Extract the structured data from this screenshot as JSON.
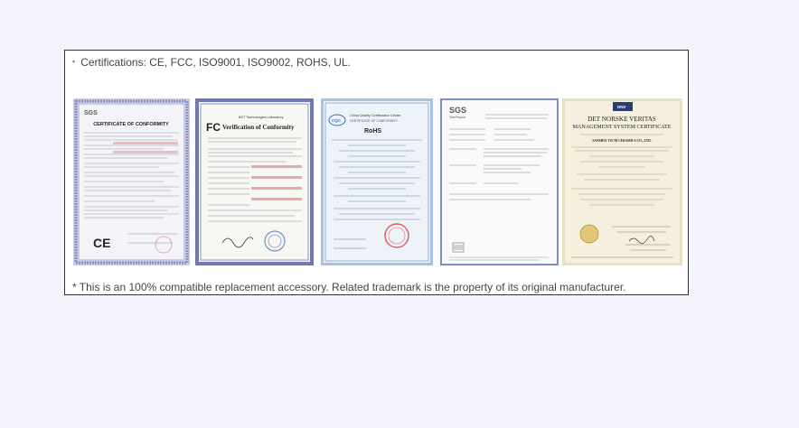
{
  "certifications_line": "Certifications: CE, FCC, ISO9001, ISO9002, ROHS, UL.",
  "bullet_symbol": "▪",
  "footer_note": "* This is an 100% compatible replacement accessory. Related trademark is the property of its original manufacturer.",
  "certificates": [
    {
      "id": "ce",
      "brand": "SGS",
      "title": "CERTIFICATE OF CONFORMITY",
      "mark": "CE",
      "border_color": "#8d93c9"
    },
    {
      "id": "fcc",
      "lab": "BST Technologies Laboratory",
      "title": "Verification of Conformity",
      "mark": "FC",
      "border_color": "#5560a6"
    },
    {
      "id": "rohs",
      "org": "China Quality Certification Centre",
      "subtitle": "CERTIFICATE OF CONFORMITY",
      "title": "RoHS",
      "mark": "CQC",
      "border_color": "#9bb6d8"
    },
    {
      "id": "sgs",
      "brand": "SGS",
      "subtitle": "Test Report",
      "border_color": "#6b7fb5"
    },
    {
      "id": "dnv",
      "org": "DET NORSKE VERITAS",
      "title": "MANAGEMENT SYSTEM CERTIFICATE",
      "company": "SANSHUI TUCM CERAMICS CO., LTD.",
      "mark": "DNV",
      "border_color": "#d8c8a0"
    }
  ],
  "colors": {
    "page_bg": "#f3f4fb",
    "panel_border": "#333333",
    "text": "#444444"
  }
}
